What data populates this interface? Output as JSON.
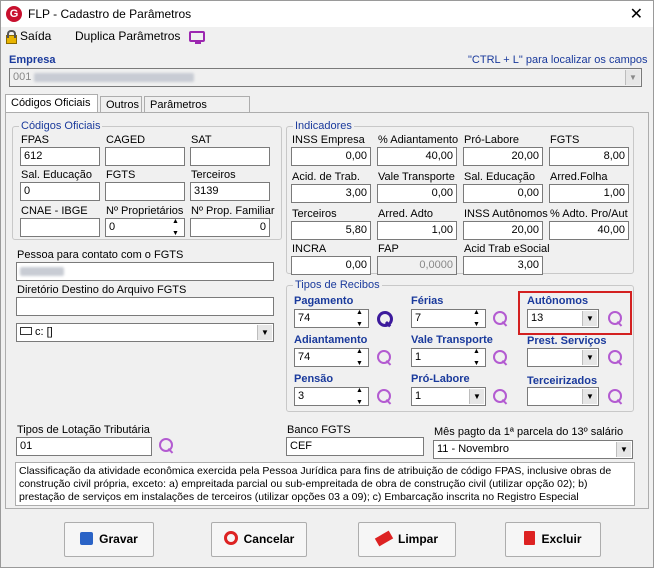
{
  "window": {
    "title": "FLP - Cadastro de Parâmetros",
    "close": "✕"
  },
  "toolbar": {
    "exit": "Saída",
    "duplicate": "Duplica Parâmetros"
  },
  "empresa": {
    "label": "Empresa",
    "hint": "\"CTRL + L\" para localizar os campos",
    "code": "001"
  },
  "tabs": [
    "Códigos Oficiais",
    "Outros",
    "Parâmetros Internos"
  ],
  "codigos": {
    "title": "Códigos Oficiais",
    "fpas": {
      "label": "FPAS",
      "value": "612"
    },
    "caged": {
      "label": "CAGED",
      "value": ""
    },
    "sat": {
      "label": "SAT",
      "value": ""
    },
    "sal_educ": {
      "label": "Sal. Educação",
      "value": "0"
    },
    "fgts": {
      "label": "FGTS",
      "value": ""
    },
    "terceiros": {
      "label": "Terceiros",
      "value": "3139"
    },
    "cnae": {
      "label": "CNAE - IBGE",
      "value": ""
    },
    "n_prop": {
      "label": "Nº Proprietários",
      "value": "0"
    },
    "n_prop_fam": {
      "label": "Nº Prop. Familiar",
      "value": "0"
    }
  },
  "contato": {
    "label": "Pessoa para contato com o FGTS"
  },
  "diretorio": {
    "label": "Diretório Destino do Arquivo FGTS",
    "drive": "c: []"
  },
  "indicadores": {
    "title": "Indicadores",
    "inss_empresa": {
      "label": "INSS Empresa",
      "value": "0,00"
    },
    "adiantamento": {
      "label": "% Adiantamento",
      "value": "40,00"
    },
    "pro_labore": {
      "label": "Pró-Labore",
      "value": "20,00"
    },
    "fgts": {
      "label": "FGTS",
      "value": "8,00"
    },
    "acid_trab": {
      "label": "Acid. de Trab.",
      "value": "3,00"
    },
    "vale_transp": {
      "label": "Vale Transporte",
      "value": "0,00"
    },
    "sal_educ": {
      "label": "Sal. Educação",
      "value": "0,00"
    },
    "arred_folha": {
      "label": "Arred.Folha",
      "value": "1,00"
    },
    "terceiros": {
      "label": "Terceiros",
      "value": "5,80"
    },
    "arred_adto": {
      "label": "Arred. Adto",
      "value": "1,00"
    },
    "inss_auto": {
      "label": "INSS Autônomos",
      "value": "20,00"
    },
    "adto_pro_aut": {
      "label": "% Adto. Pro/Aut",
      "value": "40,00"
    },
    "incra": {
      "label": "INCRA",
      "value": "0,00"
    },
    "fap": {
      "label": "FAP",
      "value": "0,0000"
    },
    "acid_esocial": {
      "label": "Acid Trab eSocial",
      "value": "3,00"
    }
  },
  "recibos": {
    "title": "Tipos de Recibos",
    "pagamento": {
      "label": "Pagamento",
      "value": "74"
    },
    "ferias": {
      "label": "Férias",
      "value": "7"
    },
    "autonomos": {
      "label": "Autônomos",
      "value": "13"
    },
    "adiantamento": {
      "label": "Adiantamento",
      "value": "74"
    },
    "vale_transp": {
      "label": "Vale Transporte",
      "value": "1"
    },
    "prest_serv": {
      "label": "Prest. Serviços",
      "value": ""
    },
    "pensao": {
      "label": "Pensão",
      "value": "3"
    },
    "pro_labore": {
      "label": "Pró-Labore",
      "value": "1"
    },
    "terceirizados": {
      "label": "Terceirizados",
      "value": ""
    }
  },
  "lotacao": {
    "label": "Tipos de Lotação Tributária",
    "value": "01"
  },
  "banco": {
    "label": "Banco FGTS",
    "value": "CEF"
  },
  "mes13": {
    "label": "Mês pagto da 1ª parcela do 13º salário",
    "value": "11 - Novembro"
  },
  "classificacao": "Classificação da atividade econômica exercida pela Pessoa Jurídica para fins de atribuição de código FPAS, inclusive obras de construção civil própria, exceto: a) empreitada parcial ou sub-empreitada de obra de construção civil (utilizar opção 02); b) prestação de serviços em instalações de terceiros (utilizar opções 03 a 09); c) Embarcação inscrita no Registro Especial",
  "buttons": {
    "save": "Gravar",
    "cancel": "Cancelar",
    "clear": "Limpar",
    "delete": "Excluir"
  }
}
